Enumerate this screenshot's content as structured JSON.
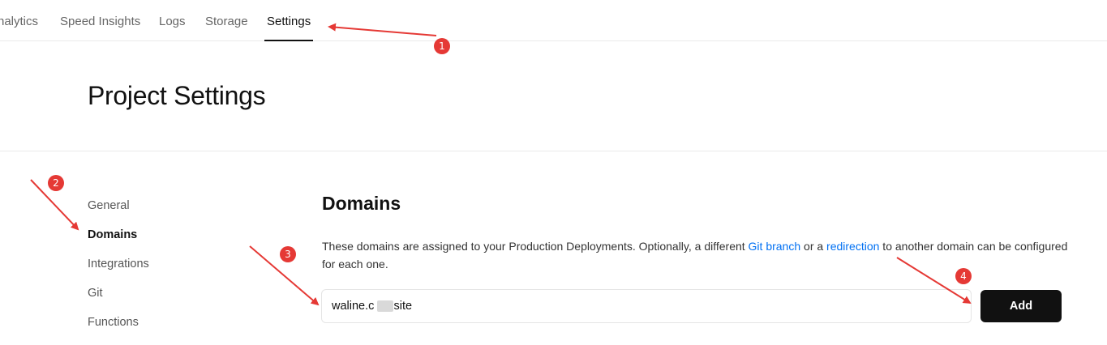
{
  "nav": {
    "tabs": [
      {
        "label": "nalytics"
      },
      {
        "label": "Speed Insights"
      },
      {
        "label": "Logs"
      },
      {
        "label": "Storage"
      },
      {
        "label": "Settings",
        "active": true
      }
    ]
  },
  "page": {
    "title": "Project Settings"
  },
  "sidebar": {
    "items": [
      {
        "label": "General"
      },
      {
        "label": "Domains",
        "active": true
      },
      {
        "label": "Integrations"
      },
      {
        "label": "Git"
      },
      {
        "label": "Functions"
      }
    ]
  },
  "domains": {
    "title": "Domains",
    "desc_before": "These domains are assigned to your Production Deployments. Optionally, a different ",
    "link_git_branch": "Git branch",
    "desc_middle": " or a ",
    "link_redirection": "redirection",
    "desc_after": " to another domain can be configured for each one.",
    "input_value": "waline.c     .site",
    "add_label": "Add"
  },
  "annotations": {
    "badges": [
      "1",
      "2",
      "3",
      "4"
    ],
    "color": "#e53935"
  },
  "colors": {
    "link": "#0070f3",
    "button_bg": "#111111",
    "border": "#eaeaea"
  }
}
